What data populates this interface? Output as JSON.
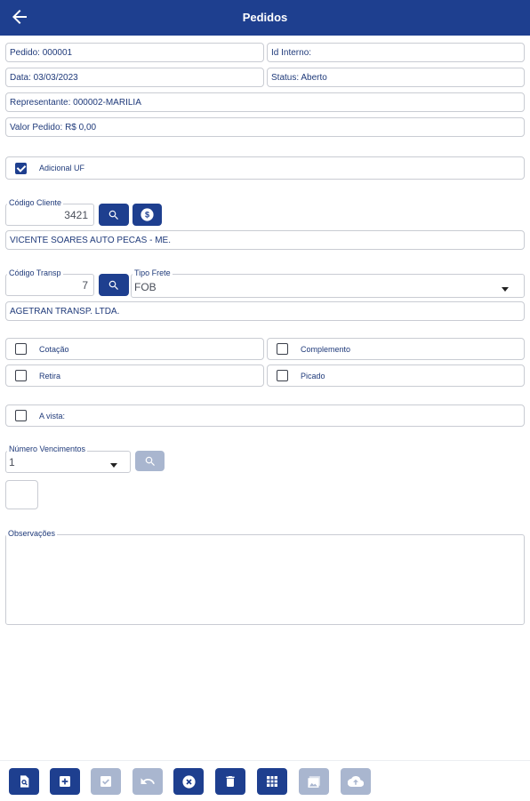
{
  "header": {
    "title": "Pedidos",
    "back_icon": "arrow-left-icon"
  },
  "order": {
    "pedido": "Pedido: 000001",
    "id_interno": "Id Interno:",
    "data": "Data: 03/03/2023",
    "status": "Status: Aberto",
    "representante": "Representante: 000002-MARILIA",
    "valor": "Valor Pedido: R$ 0,00"
  },
  "adicional_uf": {
    "label": "Adicional UF",
    "checked": true
  },
  "cliente": {
    "label": "Código Cliente",
    "value": "3421",
    "name": "VICENTE SOARES AUTO PECAS - ME."
  },
  "transp": {
    "label": "Código Transp",
    "value": "7",
    "name": "AGETRAN TRANSP. LTDA."
  },
  "frete": {
    "label": "Tipo Frete",
    "value": "FOB"
  },
  "options": {
    "cotacao": "Cotação",
    "complemento": "Complemento",
    "retira": "Retira",
    "picado": "Picado",
    "a_vista": "A vista:"
  },
  "vencimentos": {
    "label": "Número Vencimentos",
    "value": "1"
  },
  "observacoes": {
    "label": "Observações",
    "value": ""
  },
  "toolbar": {
    "buttons": [
      {
        "name": "search-doc-icon",
        "enabled": true
      },
      {
        "name": "add-icon",
        "enabled": true
      },
      {
        "name": "check-icon",
        "enabled": false
      },
      {
        "name": "undo-icon",
        "enabled": false
      },
      {
        "name": "cancel-icon",
        "enabled": true
      },
      {
        "name": "trash-icon",
        "enabled": true
      },
      {
        "name": "grid-icon",
        "enabled": true
      },
      {
        "name": "image-icon",
        "enabled": false
      },
      {
        "name": "cloud-upload-icon",
        "enabled": false
      }
    ]
  },
  "colors": {
    "primary": "#1e3f8f",
    "disabled": "#a9b6cf",
    "border": "#c9ccd3",
    "text": "#1f3a7a"
  }
}
